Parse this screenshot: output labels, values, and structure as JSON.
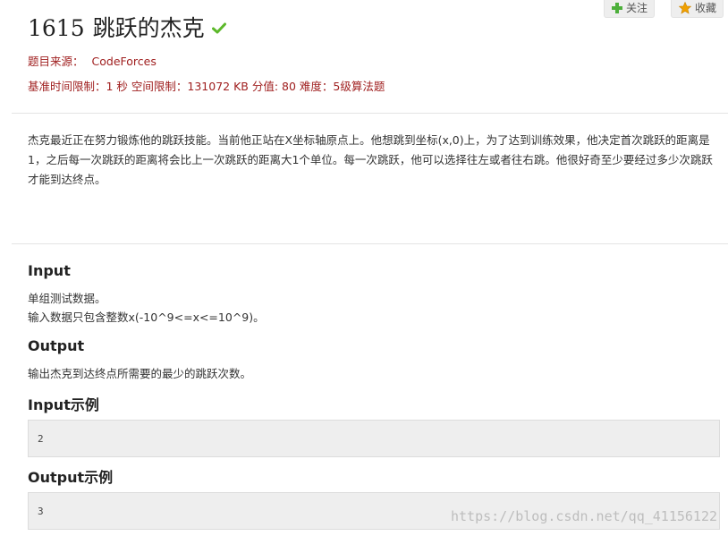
{
  "actions": {
    "follow_label": "关注",
    "favorite_label": "收藏"
  },
  "problem": {
    "id": "1615",
    "title": "跳跃的杰克",
    "source_label": "题目来源：",
    "source_value": "CodeForces",
    "limits": "基准时间限制：1 秒 空间限制：131072 KB 分值: 80 难度：5级算法题"
  },
  "description": "杰克最近正在努力锻炼他的跳跃技能。当前他正站在X坐标轴原点上。他想跳到坐标(x,0)上，为了达到训练效果，他决定首次跳跃的距离是1，之后每一次跳跃的距离将会比上一次跳跃的距离大1个单位。每一次跳跃，他可以选择往左或者往右跳。他很好奇至少要经过多少次跳跃才能到达终点。",
  "input": {
    "title": "Input",
    "lines": [
      "单组测试数据。",
      "输入数据只包含整数x(-10^9<=x<=10^9)。"
    ]
  },
  "output": {
    "title": "Output",
    "lines": [
      "输出杰克到达终点所需要的最少的跳跃次数。"
    ]
  },
  "input_example": {
    "title": "Input示例",
    "value": "2"
  },
  "output_example": {
    "title": "Output示例",
    "value": "3"
  },
  "watermark": "https://blog.csdn.net/qq_41156122",
  "colors": {
    "meta_red": "#a02020",
    "check_green": "#5cb82a",
    "plus_green": "#4caf3a",
    "star_orange": "#f0a000"
  }
}
